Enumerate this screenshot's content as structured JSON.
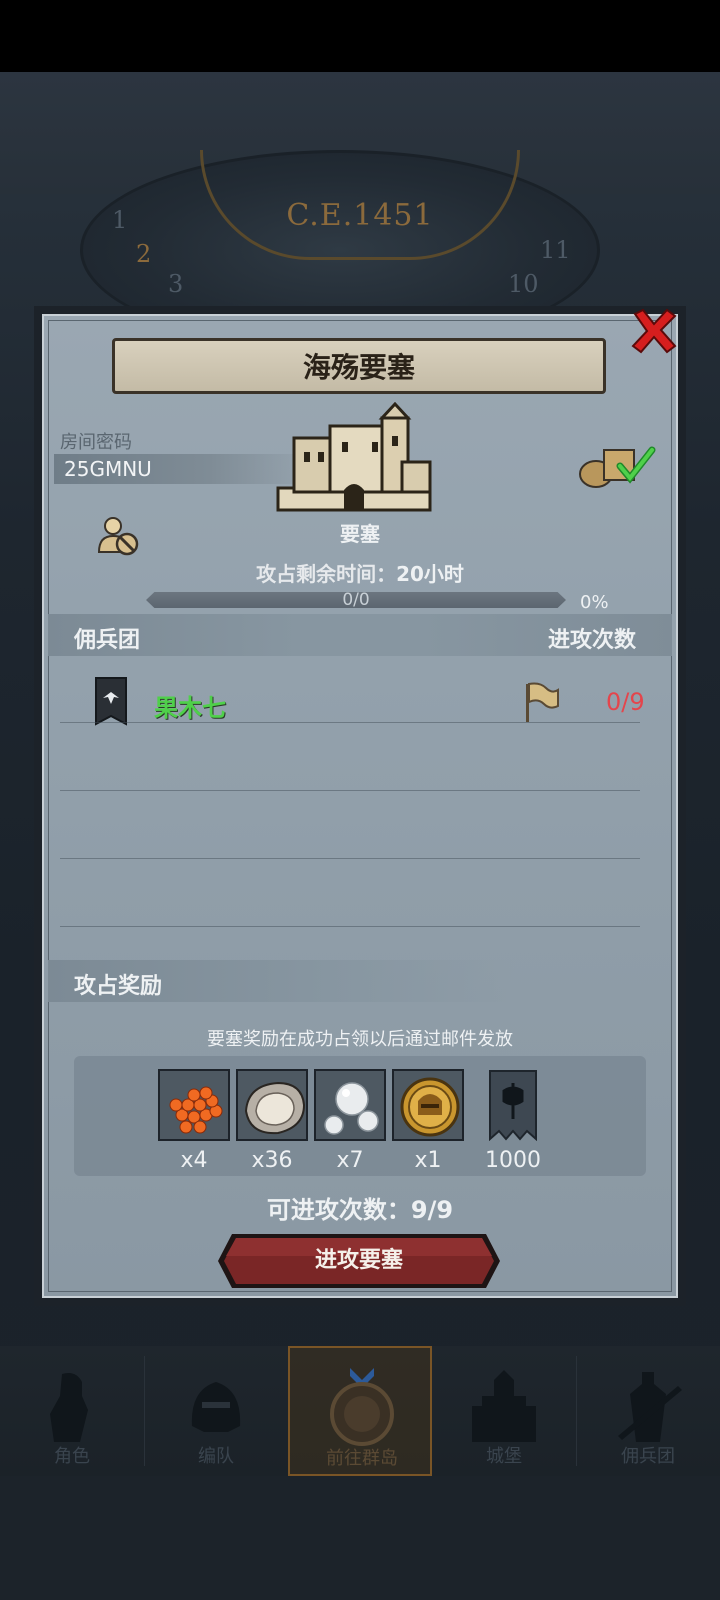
{
  "header": {
    "year": "C.E.1451",
    "clock_numerals": [
      "1",
      "2",
      "3",
      "10",
      "11"
    ]
  },
  "dialog": {
    "title": "海殇要塞",
    "room_label": "房间密码",
    "room_code": "25GMNU",
    "building_label": "要塞",
    "time_label": "攻占剩余时间：",
    "time_value": "20小时",
    "progress_text": "0/0",
    "progress_percent": "0%",
    "progress_fraction": 0,
    "mercenary_header": "佣兵团",
    "attack_count_header": "进攻次数",
    "guilds": [
      {
        "name": "果木七",
        "attacks": "0/9"
      }
    ],
    "reward_header": "攻占奖励",
    "reward_note": "要塞奖励在成功占领以后通过邮件发放",
    "rewards": [
      {
        "icon": "roe-icon",
        "count": "x4"
      },
      {
        "icon": "oyster-icon",
        "count": "x36"
      },
      {
        "icon": "pearl-icon",
        "count": "x7"
      },
      {
        "icon": "golden-helmet-coin-icon",
        "count": "x1"
      },
      {
        "icon": "guild-banner-icon",
        "count": "1000"
      }
    ],
    "attacks_available_label": "可进攻次数：",
    "attacks_available_value": "9/9",
    "attack_button": "进攻要塞"
  },
  "navbar": {
    "items": [
      {
        "label": "角色",
        "icon": "knight-icon",
        "active": false
      },
      {
        "label": "编队",
        "icon": "helmet-icon",
        "active": false
      },
      {
        "label": "前往群岛",
        "icon": "compass-icon",
        "active": true
      },
      {
        "label": "城堡",
        "icon": "castle-icon",
        "active": false
      },
      {
        "label": "佣兵团",
        "icon": "mercenary-icon",
        "active": false
      }
    ]
  },
  "colors": {
    "guild_name": "#4fd04a",
    "attack_count": "#e4454c",
    "button_red": "#7a2626",
    "close_red": "#d61e1e"
  }
}
